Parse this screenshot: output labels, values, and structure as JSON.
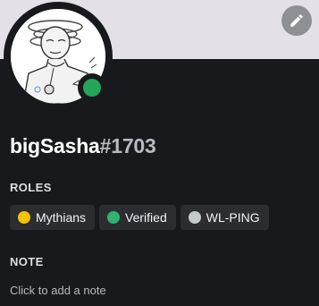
{
  "profile": {
    "username": "bigSasha",
    "discriminator": "#1703",
    "status": "online",
    "status_color": "#23a55a",
    "banner_color": "#e3e0e8"
  },
  "roles_section": {
    "title": "ROLES",
    "roles": [
      {
        "name": "Mythians",
        "color": "#f0c400"
      },
      {
        "name": "Verified",
        "color": "#2fb36f"
      },
      {
        "name": "WL-PING",
        "color": "#c4c9ce"
      }
    ]
  },
  "note_section": {
    "title": "NOTE",
    "placeholder": "Click to add a note"
  },
  "icons": {
    "edit": "pencil-icon"
  }
}
